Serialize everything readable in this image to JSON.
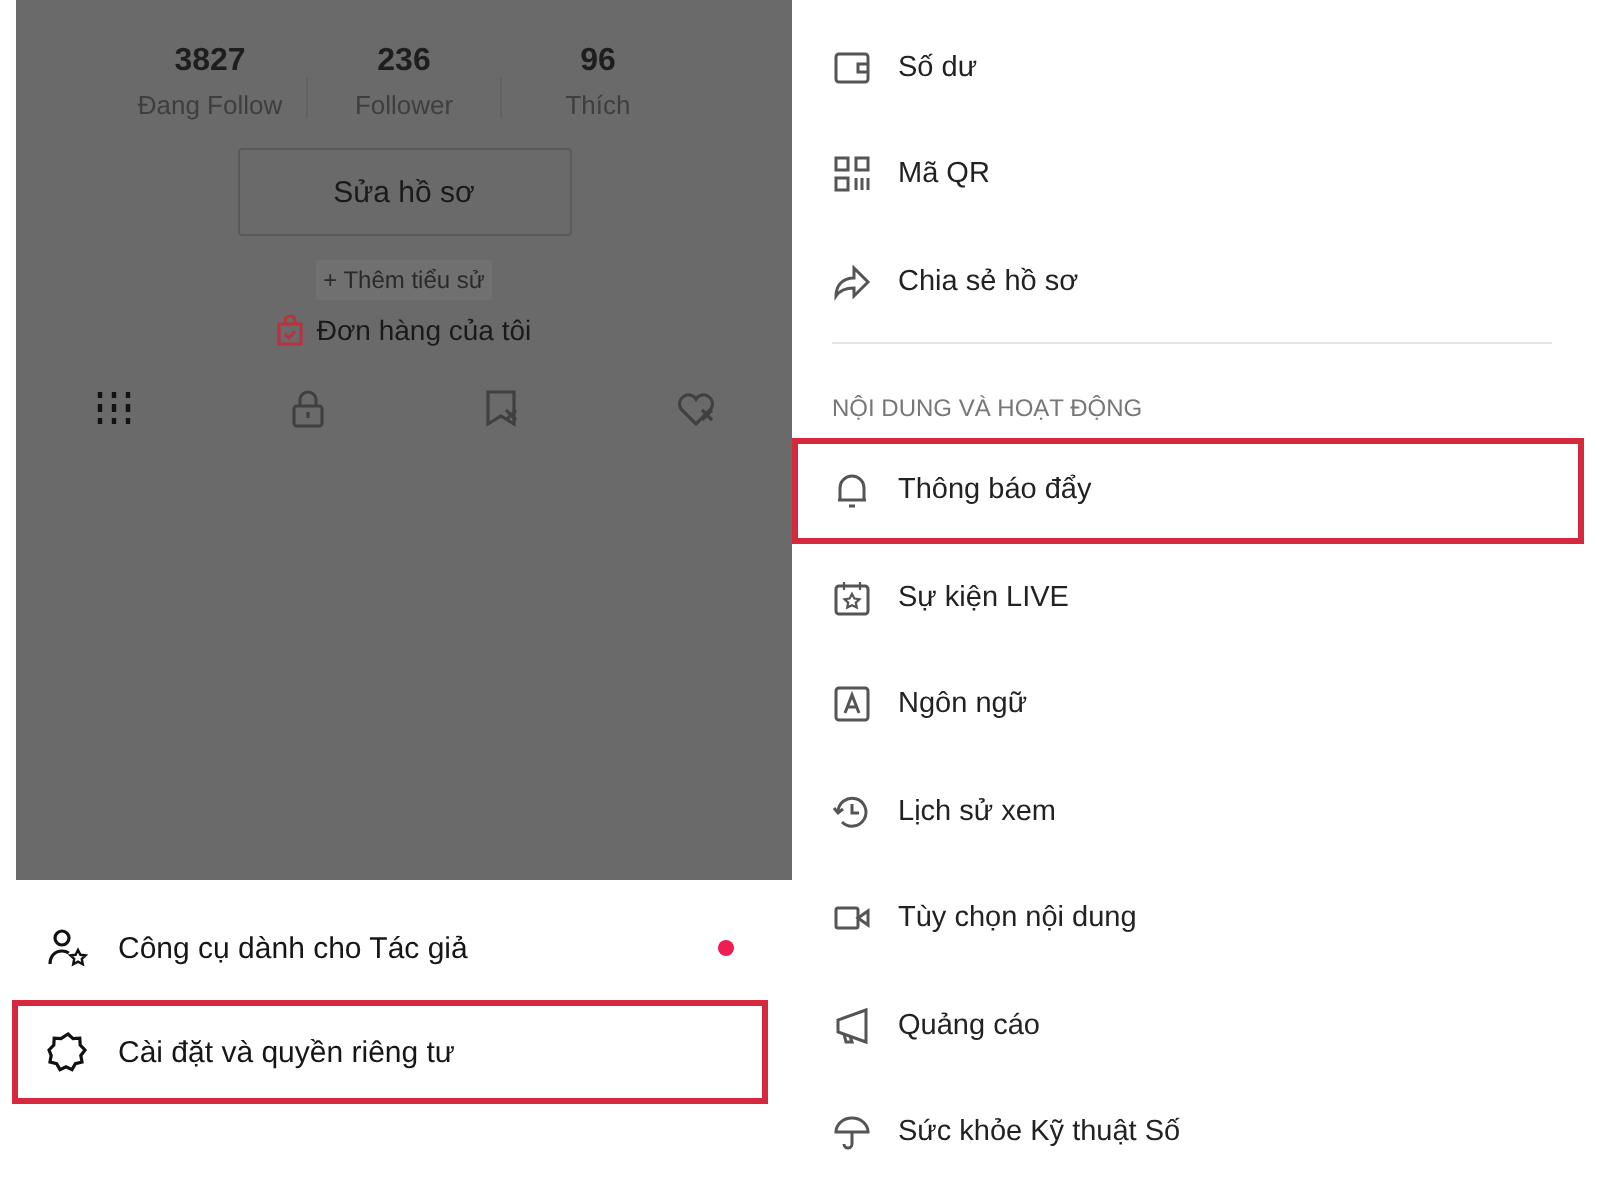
{
  "profile": {
    "stats": [
      {
        "value": "3827",
        "label": "Đang Follow"
      },
      {
        "value": "236",
        "label": "Follower"
      },
      {
        "value": "96",
        "label": "Thích"
      }
    ],
    "edit_button": "Sửa hồ sơ",
    "add_bio": "+ Thêm tiểu sử",
    "orders": "Đơn hàng của tôi",
    "tabs": [
      {
        "selected": true
      },
      {
        "selected": false
      },
      {
        "selected": false
      },
      {
        "selected": false
      }
    ]
  },
  "bottom_sheet": {
    "items": [
      {
        "label": "Công cụ dành cho Tác giả",
        "dot": true,
        "highlighted": false
      },
      {
        "label": "Cài đặt và quyền riêng tư",
        "dot": false,
        "highlighted": true
      }
    ]
  },
  "settings": {
    "account_items": [
      {
        "label": "Số dư",
        "highlighted": false
      },
      {
        "label": "Mã QR",
        "highlighted": false
      },
      {
        "label": "Chia sẻ hồ sơ",
        "highlighted": false
      }
    ],
    "section_title": "NỘI DUNG VÀ HOẠT ĐỘNG",
    "content_items": [
      {
        "label": "Thông báo đẩy",
        "highlighted": true
      },
      {
        "label": "Sự kiện LIVE",
        "highlighted": false
      },
      {
        "label": "Ngôn ngữ",
        "highlighted": false
      },
      {
        "label": "Lịch sử xem",
        "highlighted": false
      },
      {
        "label": "Tùy chọn nội dung",
        "highlighted": false
      },
      {
        "label": "Quảng cáo",
        "highlighted": false
      },
      {
        "label": "Sức khỏe Kỹ thuật Số",
        "highlighted": false
      }
    ]
  }
}
